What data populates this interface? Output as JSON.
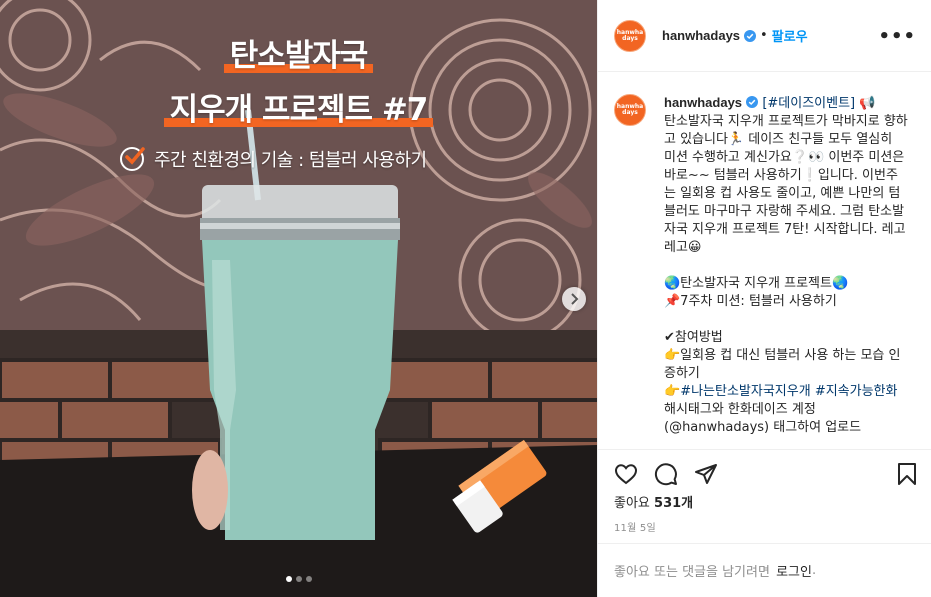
{
  "post": {
    "title_line1": "탄소발자국",
    "title_line2": "지우개 프로젝트 #7",
    "subtitle": "주간 친환경의 기술 : 텀블러 사용하기",
    "carousel_dots": 3,
    "active_dot": 0
  },
  "header": {
    "avatar_text_1": "hanwha",
    "avatar_text_2": "days",
    "username": "hanwhadays",
    "separator": "•",
    "follow_label": "팔로우",
    "more_label": "•••"
  },
  "caption": {
    "username": "hanwhadays",
    "text_1": " ",
    "hashtag_event": "[#데이즈이벤트]",
    "text_2": " 📢\n탄소발자국 지우개 프로젝트가 막바지로 향하고 있습니다🏃 데이즈 친구들 모두 열심히 미션 수행하고 계신가요❔👀 이번주 미션은 바로~~ 텀블러 사용하기❕입니다. 이번주는 일회용 컵 사용도 줄이고, 예쁜 나만의 텀블러도 마구마구 자랑해 주세요. 그럼 탄소발자국 지우개 프로젝트 7탄! 시작합니다. 레고레고😀\n\n🌏탄소발자국 지우개 프로젝트🌏\n📌7주차 미션: 텀블러 사용하기\n\n✔참여방법\n👉일회용 컵 대신 텀블러 사용 하는 모습 인증하기\n👉",
    "hashtag_1": "#나는탄소발자국지우개",
    "text_3": " ",
    "hashtag_2": "#지속가능한화",
    "text_4": " 해시태그와 한화데이즈 계정\n(@hanwhadays) 태그하여 업로드"
  },
  "actions": {
    "likes_prefix": "좋아요",
    "likes_count": "531개",
    "date": "11월 5일"
  },
  "comment": {
    "prompt": "좋아요 또는 댓글을 남기려면",
    "login_label": "로그인",
    "suffix": "."
  },
  "colors": {
    "brand_orange": "#f26522",
    "link_blue": "#0095f6",
    "hashtag_navy": "#00376b",
    "tumbler": "#93c7bb"
  },
  "icons": [
    "verified-badge-icon",
    "more-options-icon",
    "heart-icon",
    "comment-icon",
    "share-icon",
    "bookmark-icon",
    "chevron-right-icon",
    "checkmark-icon"
  ]
}
